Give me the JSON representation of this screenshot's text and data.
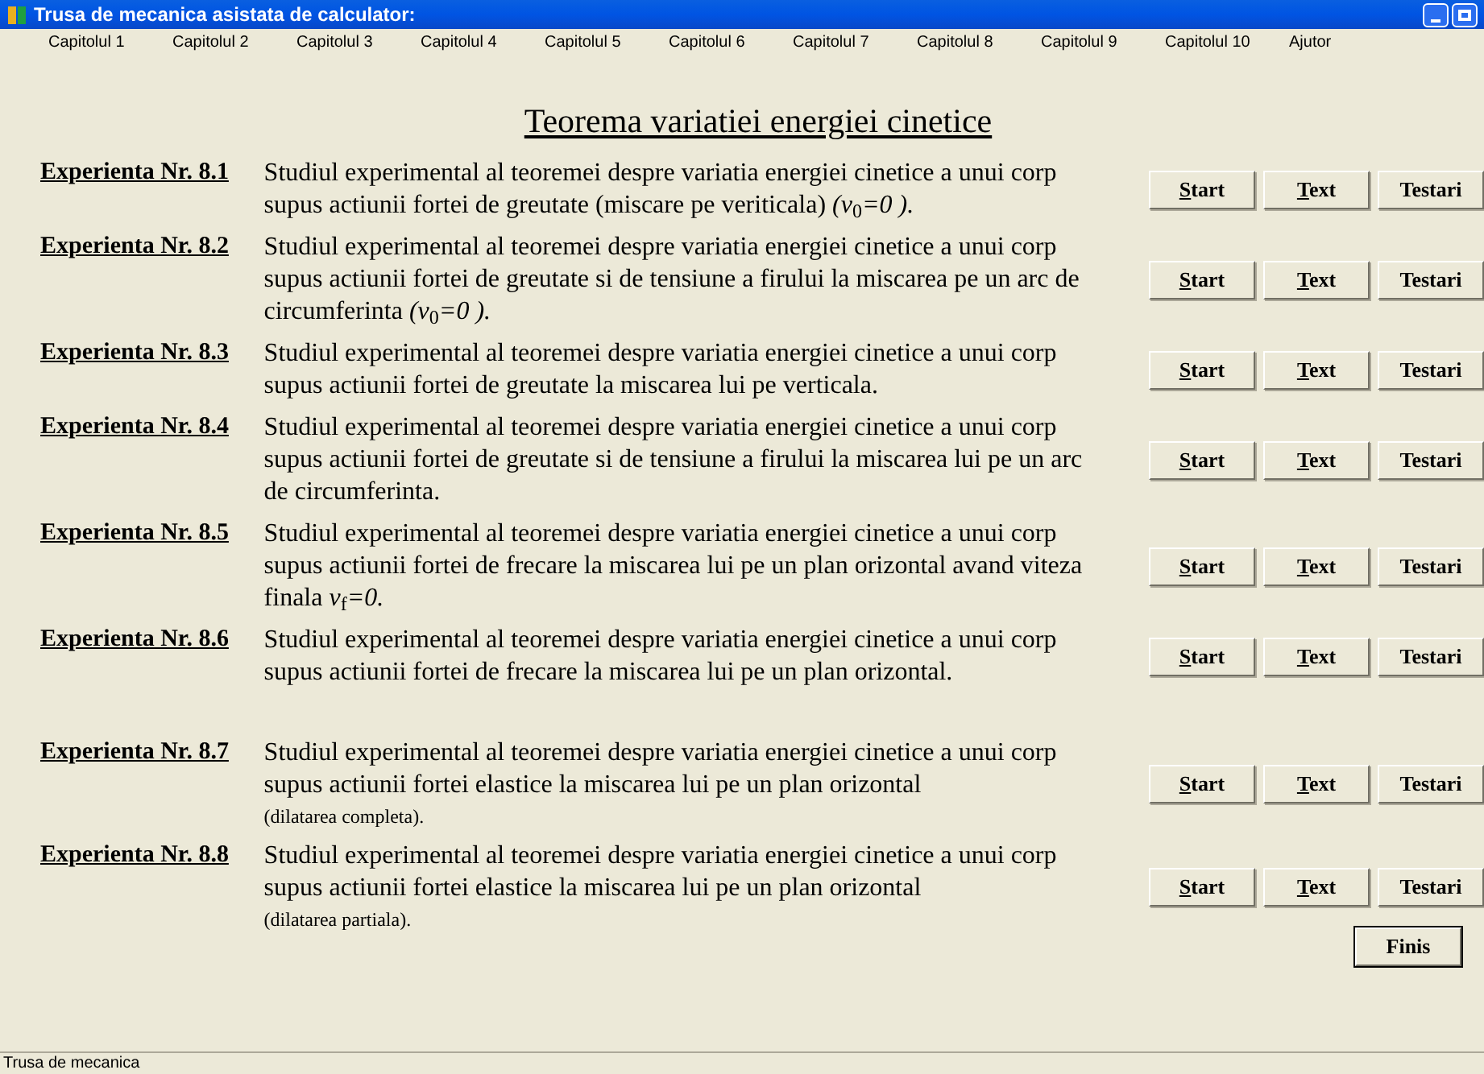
{
  "window": {
    "title": "Trusa de mecanica asistata de calculator:"
  },
  "menu": [
    "Capitolul 1",
    "Capitolul 2",
    "Capitolul 3",
    "Capitolul 4",
    "Capitolul 5",
    "Capitolul 6",
    "Capitolul 7",
    "Capitolul 8",
    "Capitolul 9",
    "Capitolul 10",
    "Ajutor"
  ],
  "heading": "Teorema variatiei energiei cinetice",
  "experiments": [
    {
      "label": "Experienta Nr. 8.1",
      "text": "Studiul experimental al teoremei despre variatia energiei cinetice a unui corp supus actiunii fortei  de greutate (miscare pe veriticala)  *(v*$_{0}$*=0 ).*",
      "buttons": [
        {
          "label": "Start",
          "mnemonic": true
        },
        {
          "label": "Text",
          "mnemonic": true
        },
        {
          "label": "Testari",
          "mnemonic": false
        }
      ]
    },
    {
      "label": "Experienta Nr. 8.2",
      "text": "Studiul experimental al teoremei despre variatia energiei cinetice a unui corp supus actiunii fortei de greutate si de tensiune a firului la miscarea pe un arc  de circumferinta *(v*$_{0}$*=0 ).*",
      "buttons": [
        {
          "label": "Start",
          "mnemonic": true
        },
        {
          "label": "Text",
          "mnemonic": true
        },
        {
          "label": "Testari",
          "mnemonic": false
        }
      ]
    },
    {
      "label": "Experienta Nr. 8.3",
      "text": "Studiul experimental al teoremei despre variatia energiei cinetice a unui corp supus actiunii fortei de greutate la miscarea lui pe verticala.",
      "buttons": [
        {
          "label": "Start",
          "mnemonic": true
        },
        {
          "label": "Text",
          "mnemonic": true
        },
        {
          "label": "Testari",
          "mnemonic": false
        }
      ]
    },
    {
      "label": "Experienta Nr. 8.4",
      "text": "Studiul experimental al teoremei despre variatia energiei cinetice a unui corp supus actiunii fortei de greutate si de tensiune a firului la miscarea lui pe un arc de circumferinta.",
      "buttons": [
        {
          "label": "Start",
          "mnemonic": true
        },
        {
          "label": "Text",
          "mnemonic": true
        },
        {
          "label": "Testari",
          "mnemonic": false
        }
      ]
    },
    {
      "label": "Experienta Nr. 8.5",
      "text": "Studiul experimental al teoremei despre variatia energiei cinetice a unui corp supus actiunii fortei de frecare la miscarea lui pe un plan orizontal avand viteza finala  *v*$_{f}$*=0.*",
      "buttons": [
        {
          "label": "Start",
          "mnemonic": true
        },
        {
          "label": "Text",
          "mnemonic": true
        },
        {
          "label": "Testari",
          "mnemonic": false
        }
      ]
    },
    {
      "label": "Experienta Nr. 8.6",
      "text": "Studiul experimental al teoremei despre variatia energiei cinetice a unui corp supus actiunii fortei de frecare la miscarea lui pe un plan orizontal.",
      "buttons": [
        {
          "label": "Start",
          "mnemonic": true
        },
        {
          "label": "Text",
          "mnemonic": true
        },
        {
          "label": "Testari",
          "mnemonic": false
        }
      ]
    },
    {
      "label": "Experienta Nr. 8.7",
      "text": "Studiul experimental al teoremei despre variatia energiei cinetice a unui corp supus actiunii fortei elastice la miscarea lui pe un plan orizontal",
      "note": "(dilatarea completa).",
      "buttons": [
        {
          "label": "Start",
          "mnemonic": true
        },
        {
          "label": "Text",
          "mnemonic": true
        },
        {
          "label": "Testari",
          "mnemonic": false
        }
      ]
    },
    {
      "label": "Experienta Nr. 8.8",
      "text": "Studiul experimental al teoremei despre variatia energiei cinetice a unui corp supus actiunii fortei elastice la miscarea lui pe un plan orizontal",
      "note": "(dilatarea partiala).",
      "buttons": [
        {
          "label": "Start",
          "mnemonic": true
        },
        {
          "label": "Text",
          "mnemonic": true
        },
        {
          "label": "Testari",
          "mnemonic": false
        }
      ]
    }
  ],
  "finish_button": "Finis",
  "status_bar": "Trusa de mecanica"
}
